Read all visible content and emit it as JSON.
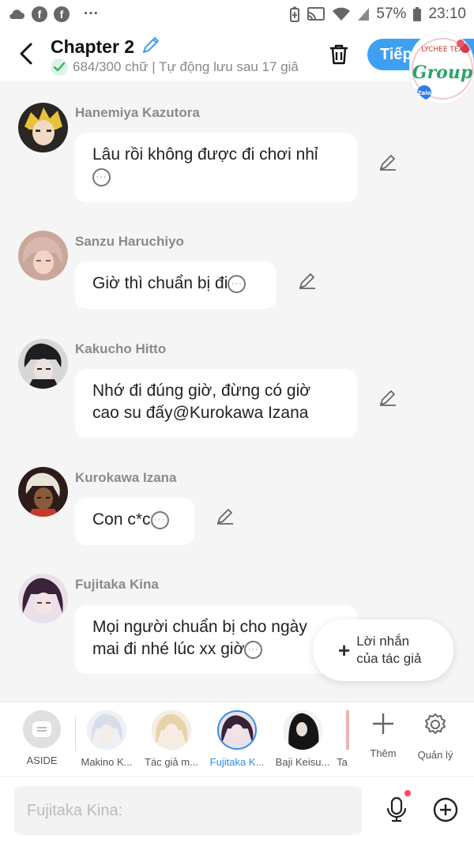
{
  "status_bar": {
    "more": "···",
    "battery": "57%",
    "time": "23:10"
  },
  "header": {
    "title": "Chapter 2",
    "subtitle": "684/300 chữ | Tự động lưu sau 17 giâ",
    "next_label": "Tiếp",
    "logo_text_1": "LYCHEE TEA",
    "logo_text_2": "Group",
    "logo_text_3": "Zalo"
  },
  "messages": [
    {
      "name": "Hanemiya Kazutora",
      "text": "Lâu rồi không được đi chơi nhỉ"
    },
    {
      "name": "Sanzu Haruchiyo",
      "text": "Giờ thì chuẩn bị đi"
    },
    {
      "name": "Kakucho Hitto",
      "text_line1": "Nhớ đi đúng giờ, đừng có giờ",
      "text_line2": "cao su đấy@Kurokawa Izana"
    },
    {
      "name": "Kurokawa Izana",
      "text": "Con c*c"
    },
    {
      "name": "Fujitaka Kina",
      "text_line1": "Mọi người chuẩn bị cho ngày",
      "text_line2": "mai đi nhé lúc xx giờ"
    }
  ],
  "float_note": {
    "line1": "Lời nhắn",
    "line2": "của tác giả"
  },
  "characters": [
    {
      "label": "ASIDE"
    },
    {
      "label": "Makino K..."
    },
    {
      "label": "Tác giả m..."
    },
    {
      "label": "Fujitaka K..."
    },
    {
      "label": "Baji Keisu..."
    },
    {
      "label": "Ta"
    }
  ],
  "tools": {
    "add_label": "Thêm",
    "manage_label": "Quản lý"
  },
  "input": {
    "placeholder": "Fujitaka Kina:"
  },
  "colors": {
    "accent": "#3ea0f3",
    "active_char": "#2f8de4",
    "background": "#f5f5f5"
  }
}
